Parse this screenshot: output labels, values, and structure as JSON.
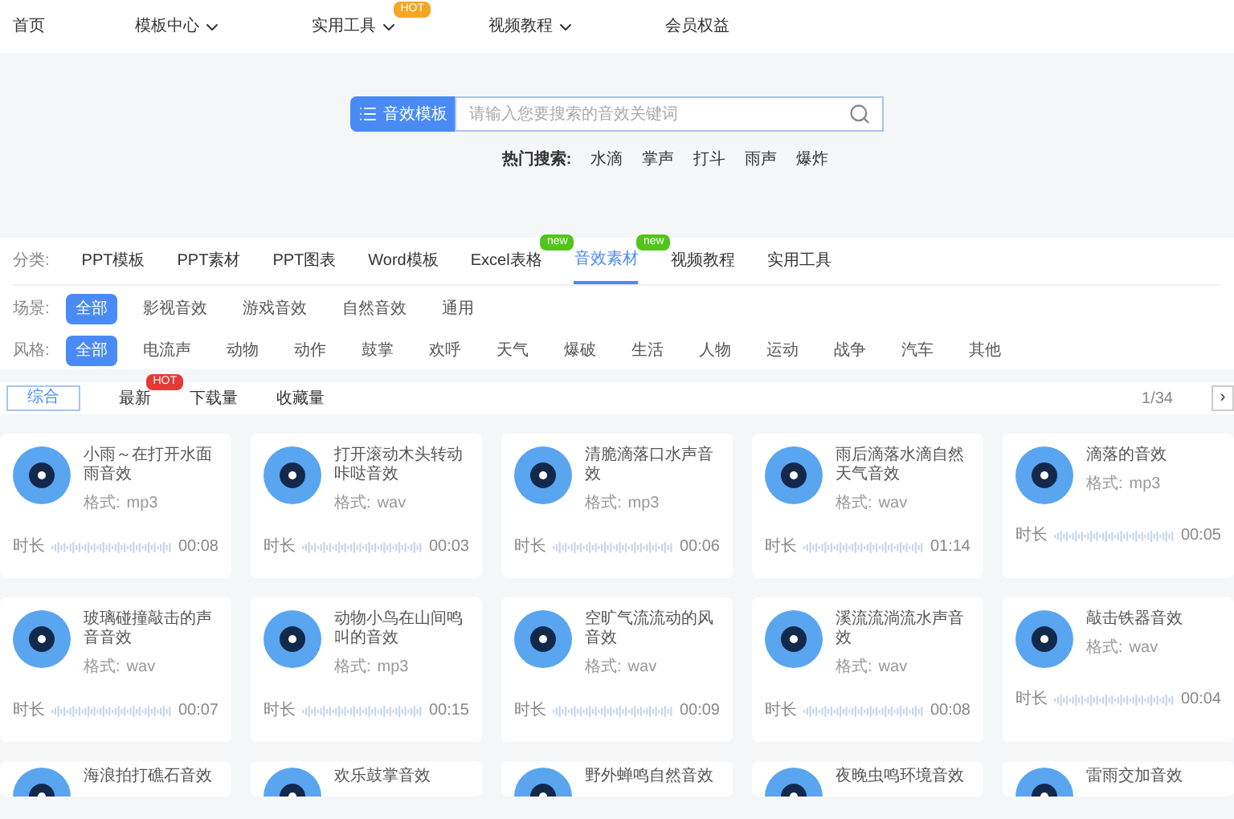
{
  "nav": {
    "items": [
      {
        "label": "首页",
        "dropdown": false
      },
      {
        "label": "模板中心",
        "dropdown": true
      },
      {
        "label": "实用工具",
        "dropdown": true,
        "badge": "HOT"
      },
      {
        "label": "视频教程",
        "dropdown": true
      },
      {
        "label": "会员权益",
        "dropdown": false
      }
    ]
  },
  "search": {
    "button": "音效模板",
    "placeholder": "请输入您要搜索的音效关键词"
  },
  "hot_searches": {
    "label": "热门搜索:",
    "items": [
      "水滴",
      "掌声",
      "打斗",
      "雨声",
      "爆炸"
    ]
  },
  "categories": {
    "label": "分类:",
    "items": [
      {
        "label": "PPT模板",
        "selected": false
      },
      {
        "label": "PPT素材",
        "selected": false
      },
      {
        "label": "PPT图表",
        "selected": false
      },
      {
        "label": "Word模板",
        "selected": false
      },
      {
        "label": "Excel表格",
        "selected": false,
        "badge": "new"
      },
      {
        "label": "音效素材",
        "selected": true,
        "badge": "new"
      },
      {
        "label": "视频教程",
        "selected": false
      },
      {
        "label": "实用工具",
        "selected": false
      }
    ]
  },
  "filters": [
    {
      "label": "场景:",
      "options": [
        {
          "label": "全部",
          "selected": true
        },
        {
          "label": "影视音效",
          "selected": false
        },
        {
          "label": "游戏音效",
          "selected": false
        },
        {
          "label": "自然音效",
          "selected": false
        },
        {
          "label": "通用",
          "selected": false
        }
      ]
    },
    {
      "label": "风格:",
      "options": [
        {
          "label": "全部",
          "selected": true
        },
        {
          "label": "电流声",
          "selected": false
        },
        {
          "label": "动物",
          "selected": false
        },
        {
          "label": "动作",
          "selected": false
        },
        {
          "label": "鼓掌",
          "selected": false
        },
        {
          "label": "欢呼",
          "selected": false
        },
        {
          "label": "天气",
          "selected": false
        },
        {
          "label": "爆破",
          "selected": false
        },
        {
          "label": "生活",
          "selected": false
        },
        {
          "label": "人物",
          "selected": false
        },
        {
          "label": "运动",
          "selected": false
        },
        {
          "label": "战争",
          "selected": false
        },
        {
          "label": "汽车",
          "selected": false
        },
        {
          "label": "其他",
          "selected": false
        }
      ]
    }
  ],
  "sort": {
    "options": [
      {
        "label": "综合",
        "selected": true
      },
      {
        "label": "最新",
        "selected": false,
        "badge": "HOT"
      },
      {
        "label": "下载量",
        "selected": false
      },
      {
        "label": "收藏量",
        "selected": false
      }
    ],
    "page": "1/34",
    "next": "›"
  },
  "cards": [
    {
      "title": "小雨～在打开水面雨音效",
      "format_label": "格式:",
      "format": "mp3",
      "duration_label": "时长",
      "duration": "00:08"
    },
    {
      "title": "打开滚动木头转动咔哒音效",
      "format_label": "格式:",
      "format": "wav",
      "duration_label": "时长",
      "duration": "00:03"
    },
    {
      "title": "清脆滴落口水声音效",
      "format_label": "格式:",
      "format": "mp3",
      "duration_label": "时长",
      "duration": "00:06"
    },
    {
      "title": "雨后滴落水滴自然天气音效",
      "format_label": "格式:",
      "format": "wav",
      "duration_label": "时长",
      "duration": "01:14"
    },
    {
      "title": "滴落的音效",
      "format_label": "格式:",
      "format": "mp3",
      "duration_label": "时长",
      "duration": "00:05"
    },
    {
      "title": "玻璃碰撞敲击的声音音效",
      "format_label": "格式:",
      "format": "wav",
      "duration_label": "时长",
      "duration": "00:07"
    },
    {
      "title": "动物小鸟在山间鸣叫的音效",
      "format_label": "格式:",
      "format": "mp3",
      "duration_label": "时长",
      "duration": "00:15"
    },
    {
      "title": "空旷气流流动的风音效",
      "format_label": "格式:",
      "format": "wav",
      "duration_label": "时长",
      "duration": "00:09"
    },
    {
      "title": "溪流流淌流水声音效",
      "format_label": "格式:",
      "format": "wav",
      "duration_label": "时长",
      "duration": "00:08"
    },
    {
      "title": "敲击铁器音效",
      "format_label": "格式:",
      "format": "wav",
      "duration_label": "时长",
      "duration": "00:04"
    },
    {
      "title": "海浪拍打礁石音效"
    },
    {
      "title": "欢乐鼓掌音效"
    },
    {
      "title": "野外蝉鸣自然音效"
    },
    {
      "title": "夜晚虫鸣环境音效"
    },
    {
      "title": "雷雨交加音效"
    }
  ]
}
